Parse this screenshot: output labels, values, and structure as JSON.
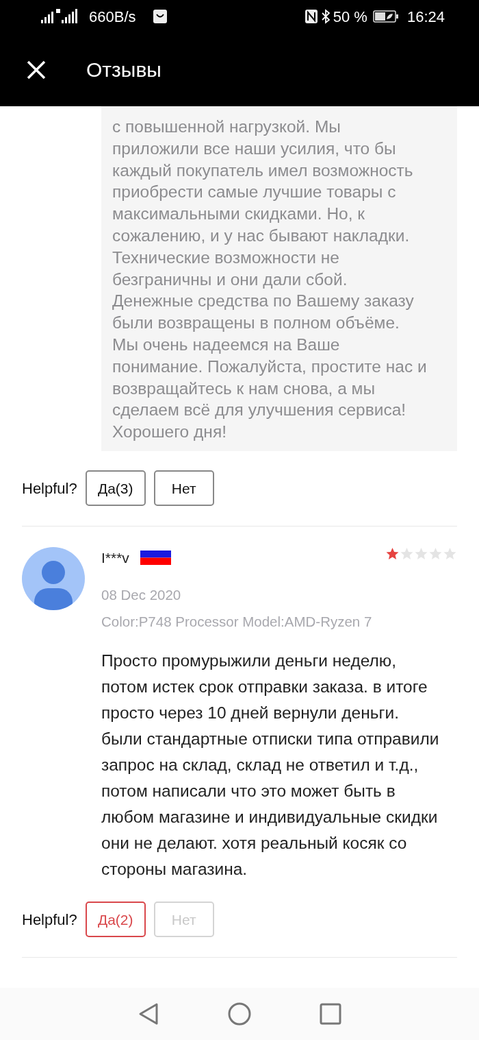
{
  "status_bar": {
    "speed": "660B/s",
    "battery": "50 %",
    "time": "16:24"
  },
  "header": {
    "title": "Отзывы"
  },
  "reviews": [
    {
      "kind": "reply-tail",
      "reply": "с повышенной нагрузкой. Мы приложили все наши усилия, что бы каждый покупатель имел возможность приобрести самые лучшие товары с максимальными скидками. Но, к сожалению, и у нас бывают накладки. Технические возможности не безграничны и они дали сбой. Денежные средства по Вашему заказу были возвращены в полном объёме. Мы очень надеемся на Ваше понимание. Пожалуйста, простите нас и возвращайтесь к нам снова, а мы сделаем всё для улучшения сервиса! Хорошего дня!",
      "helpful_label": "Helpful?",
      "votes": [
        {
          "label": "Да(3)",
          "selected": false,
          "disabled": false
        },
        {
          "label": "Нет",
          "selected": false,
          "disabled": false
        }
      ]
    },
    {
      "kind": "full",
      "author": "I***v",
      "stars": 1,
      "date": "08 Dec 2020",
      "variant": "Color:P748 Processor Model:AMD-Ryzen  7",
      "text": "Просто промурыжили деньги неделю, потом истек срок отправки заказа. в итоге просто через 10 дней вернули деньги. были стандартные отписки типа отправили запрос на склад, склад не ответил и т.д., потом написали что это может быть в любом магазине и индивидуальные скидки они не делают. хотя реальный косяк со стороны магазина.",
      "helpful_label": "Helpful?",
      "votes": [
        {
          "label": "Да(2)",
          "selected": true,
          "disabled": false
        },
        {
          "label": "Нет",
          "selected": false,
          "disabled": true
        }
      ]
    }
  ]
}
